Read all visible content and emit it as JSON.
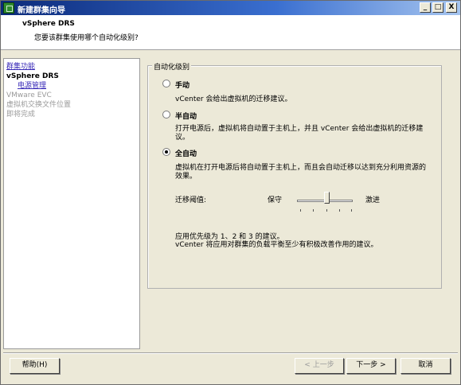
{
  "window": {
    "title": "新建群集向导",
    "controls": {
      "minimize": "_",
      "maximize": "□",
      "close": "X"
    }
  },
  "header": {
    "title": "vSphere DRS",
    "subtitle": "您要该群集使用哪个自动化级别?"
  },
  "nav": {
    "items": [
      {
        "label": "群集功能",
        "state": "link"
      },
      {
        "label": "vSphere DRS",
        "state": "current"
      },
      {
        "label": "电源管理",
        "state": "link"
      },
      {
        "label": "VMware EVC",
        "state": "disabled"
      },
      {
        "label": "虚拟机交换文件位置",
        "state": "disabled"
      },
      {
        "label": "即将完成",
        "state": "disabled"
      }
    ]
  },
  "automation": {
    "group_title": "自动化级别",
    "options": [
      {
        "label": "手动",
        "selected": false,
        "desc": [
          "vCenter 会给出虚拟机的迁移建议。"
        ]
      },
      {
        "label": "半自动",
        "selected": false,
        "desc": [
          "打开电源后，虚拟机将自动置于主机上，并且 vCenter 会给出虚拟机的迁移建",
          "议。"
        ]
      },
      {
        "label": "全自动",
        "selected": true,
        "desc": [
          "虚拟机在打开电源后将自动置于主机上，而且会自动迁移以达到充分利用资源的",
          "效果。"
        ]
      }
    ],
    "threshold": {
      "label": "迁移阈值:",
      "left": "保守",
      "right": "激进",
      "level": 3,
      "max_level": 5
    },
    "recommendation": [
      "应用优先级为 1、2 和 3 的建议。",
      "vCenter 将应用对群集的负载平衡至少有积极改善作用的建议。"
    ]
  },
  "footer": {
    "help": "帮助(H)",
    "back": "< 上一步",
    "next": "下一步 >",
    "cancel": "取消"
  }
}
